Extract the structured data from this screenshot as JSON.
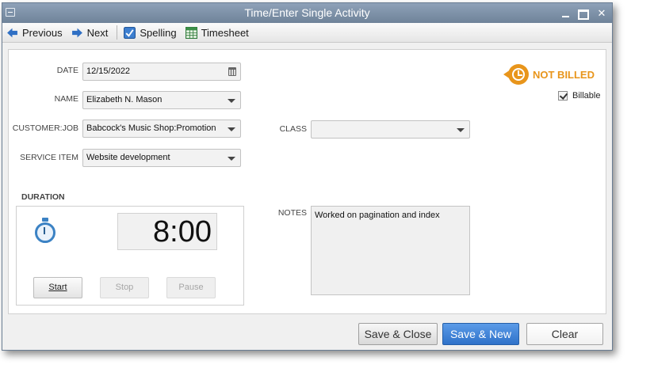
{
  "window": {
    "title": "Time/Enter Single Activity"
  },
  "toolbar": {
    "previous_label": "Previous",
    "next_label": "Next",
    "spelling_label": "Spelling",
    "timesheet_label": "Timesheet"
  },
  "form": {
    "date": {
      "label": "DATE",
      "value": "12/15/2022"
    },
    "name": {
      "label": "NAME",
      "value": "Elizabeth N. Mason"
    },
    "customer_job": {
      "label": "CUSTOMER:JOB",
      "value": "Babcock's Music Shop:Promotion"
    },
    "service_item": {
      "label": "SERVICE ITEM",
      "value": "Website development"
    },
    "class": {
      "label": "CLASS",
      "value": ""
    },
    "notes": {
      "label": "NOTES",
      "value": "Worked on pagination and index"
    }
  },
  "status": {
    "label": "NOT BILLED",
    "color": "#e8951b"
  },
  "billable": {
    "label": "Billable",
    "checked": true
  },
  "duration": {
    "label": "DURATION",
    "value": "8:00",
    "start_label": "Start",
    "stop_label": "Stop",
    "pause_label": "Pause"
  },
  "footer": {
    "save_close_label": "Save & Close",
    "save_new_label": "Save & New",
    "clear_label": "Clear"
  },
  "colors": {
    "titlebar": "#7b8ea5",
    "accent_blue": "#3b82c4",
    "status_orange": "#e8951b"
  }
}
